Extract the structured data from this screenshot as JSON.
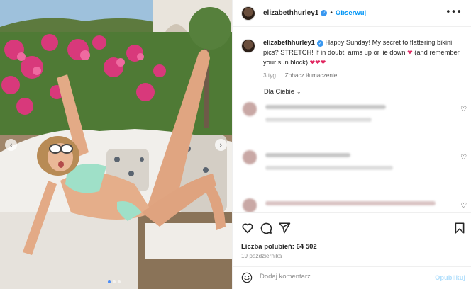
{
  "post": {
    "username": "elizabethhurley1",
    "separator": "•",
    "follow_label": "Obserwuj",
    "more_icon": "more-dots-icon",
    "verified_glyph": "✓"
  },
  "caption": {
    "username": "elizabethhurley1",
    "text": "Happy Sunday! My secret to flattering bikini pics? STRETCH! If in doubt, arms up or lie down",
    "text_tail": "(and remember your sun block)",
    "heart_mid": "❤",
    "hearts_end": "❤❤❤",
    "age": "3 tyg.",
    "translate_label": "Zobacz tłumaczenie"
  },
  "comments": {
    "sort_label": "Dla Ciebie",
    "sort_chevron": "⌄",
    "like_glyph": "♡"
  },
  "actions": {
    "like_icon": "heart-icon",
    "comment_icon": "comment-icon",
    "share_icon": "share-icon",
    "save_icon": "bookmark-icon",
    "likes_text": "Liczba polubień: 64 502",
    "date_text": "19 października"
  },
  "composer": {
    "emoji_icon": "emoji-icon",
    "placeholder": "Dodaj komentarz...",
    "publish_label": "Opublikuj"
  },
  "media": {
    "prev_glyph": "‹",
    "next_glyph": "›",
    "slide_count": 3,
    "active_slide": 1
  },
  "colors": {
    "link_blue": "#0095f6",
    "verified_blue": "#3897f0",
    "heart_red": "#e0245e",
    "muted": "#8e8e8e"
  }
}
